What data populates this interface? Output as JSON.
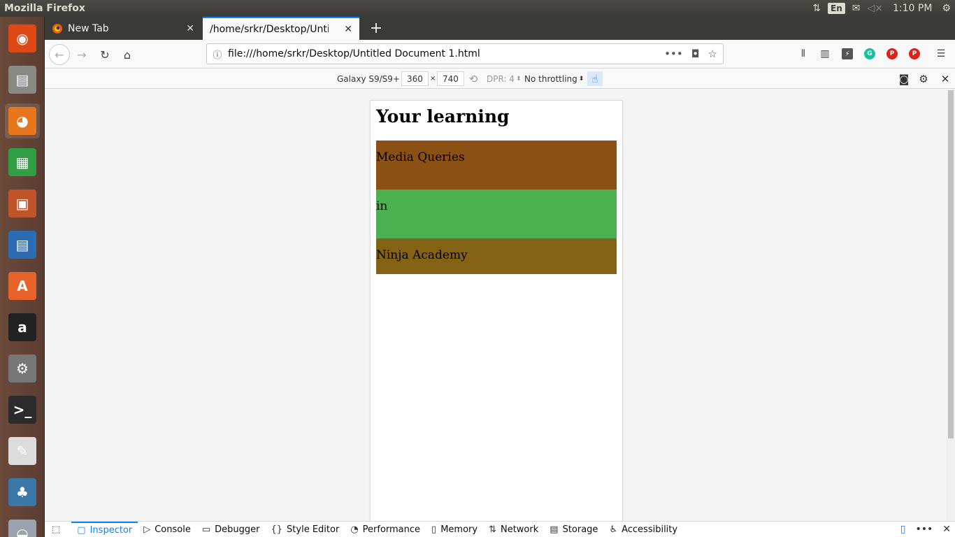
{
  "system": {
    "window_title": "Mozilla Firefox",
    "lang": "En",
    "clock": "1:10 PM"
  },
  "launcher": {
    "items": [
      {
        "name": "ubuntu-dash-icon",
        "glyph": "◉",
        "color": "#dd4814"
      },
      {
        "name": "files-icon",
        "glyph": "▤",
        "color": "#8a8a85"
      },
      {
        "name": "firefox-icon",
        "glyph": "◕",
        "color": "#e8761c"
      },
      {
        "name": "calc-icon",
        "glyph": "▦",
        "color": "#2f9e44"
      },
      {
        "name": "impress-icon",
        "glyph": "▣",
        "color": "#c0552b"
      },
      {
        "name": "writer-icon",
        "glyph": "▤",
        "color": "#2a6db3"
      },
      {
        "name": "software-center-icon",
        "glyph": "A",
        "color": "#e8632c"
      },
      {
        "name": "amazon-icon",
        "glyph": "a",
        "color": "#222222"
      },
      {
        "name": "system-settings-icon",
        "glyph": "⚙",
        "color": "#777777"
      },
      {
        "name": "terminal-icon",
        "glyph": ">_",
        "color": "#2b2b2b"
      },
      {
        "name": "text-editor-icon",
        "glyph": "✎",
        "color": "#dcdcdc"
      },
      {
        "name": "python-icon",
        "glyph": "♣",
        "color": "#3b77a8"
      },
      {
        "name": "disk-icon",
        "glyph": "◒",
        "color": "#9aa3ad"
      }
    ]
  },
  "browser": {
    "tabs": [
      {
        "label": "New Tab",
        "icon": "firefox-icon"
      },
      {
        "label": "/home/srkr/Desktop/Untitle",
        "icon": "none"
      }
    ],
    "url": "file:///home/srkr/Desktop/Untitled Document 1.html"
  },
  "rdm": {
    "device": "Galaxy S9/S9+",
    "width": "360",
    "times": "×",
    "height": "740",
    "dpr": "DPR: 4",
    "throttling": "No throttling"
  },
  "page": {
    "heading": "Your learning",
    "blocks": [
      {
        "text": "Media Queries",
        "color": "#8b5014"
      },
      {
        "text": "in",
        "color": "#4caf50"
      },
      {
        "text": "Ninja Academy",
        "color": "#836215"
      }
    ]
  },
  "devtools": {
    "tabs": [
      {
        "label": "Inspector",
        "icon": "inspector-icon",
        "glyph": "▢"
      },
      {
        "label": "Console",
        "icon": "console-icon",
        "glyph": "▷"
      },
      {
        "label": "Debugger",
        "icon": "debugger-icon",
        "glyph": "▭"
      },
      {
        "label": "Style Editor",
        "icon": "style-editor-icon",
        "glyph": "{}"
      },
      {
        "label": "Performance",
        "icon": "performance-icon",
        "glyph": "◔"
      },
      {
        "label": "Memory",
        "icon": "memory-icon",
        "glyph": "▯"
      },
      {
        "label": "Network",
        "icon": "network-icon",
        "glyph": "⇅"
      },
      {
        "label": "Storage",
        "icon": "storage-icon",
        "glyph": "▤"
      },
      {
        "label": "Accessibility",
        "icon": "accessibility-icon",
        "glyph": "♿"
      }
    ]
  }
}
